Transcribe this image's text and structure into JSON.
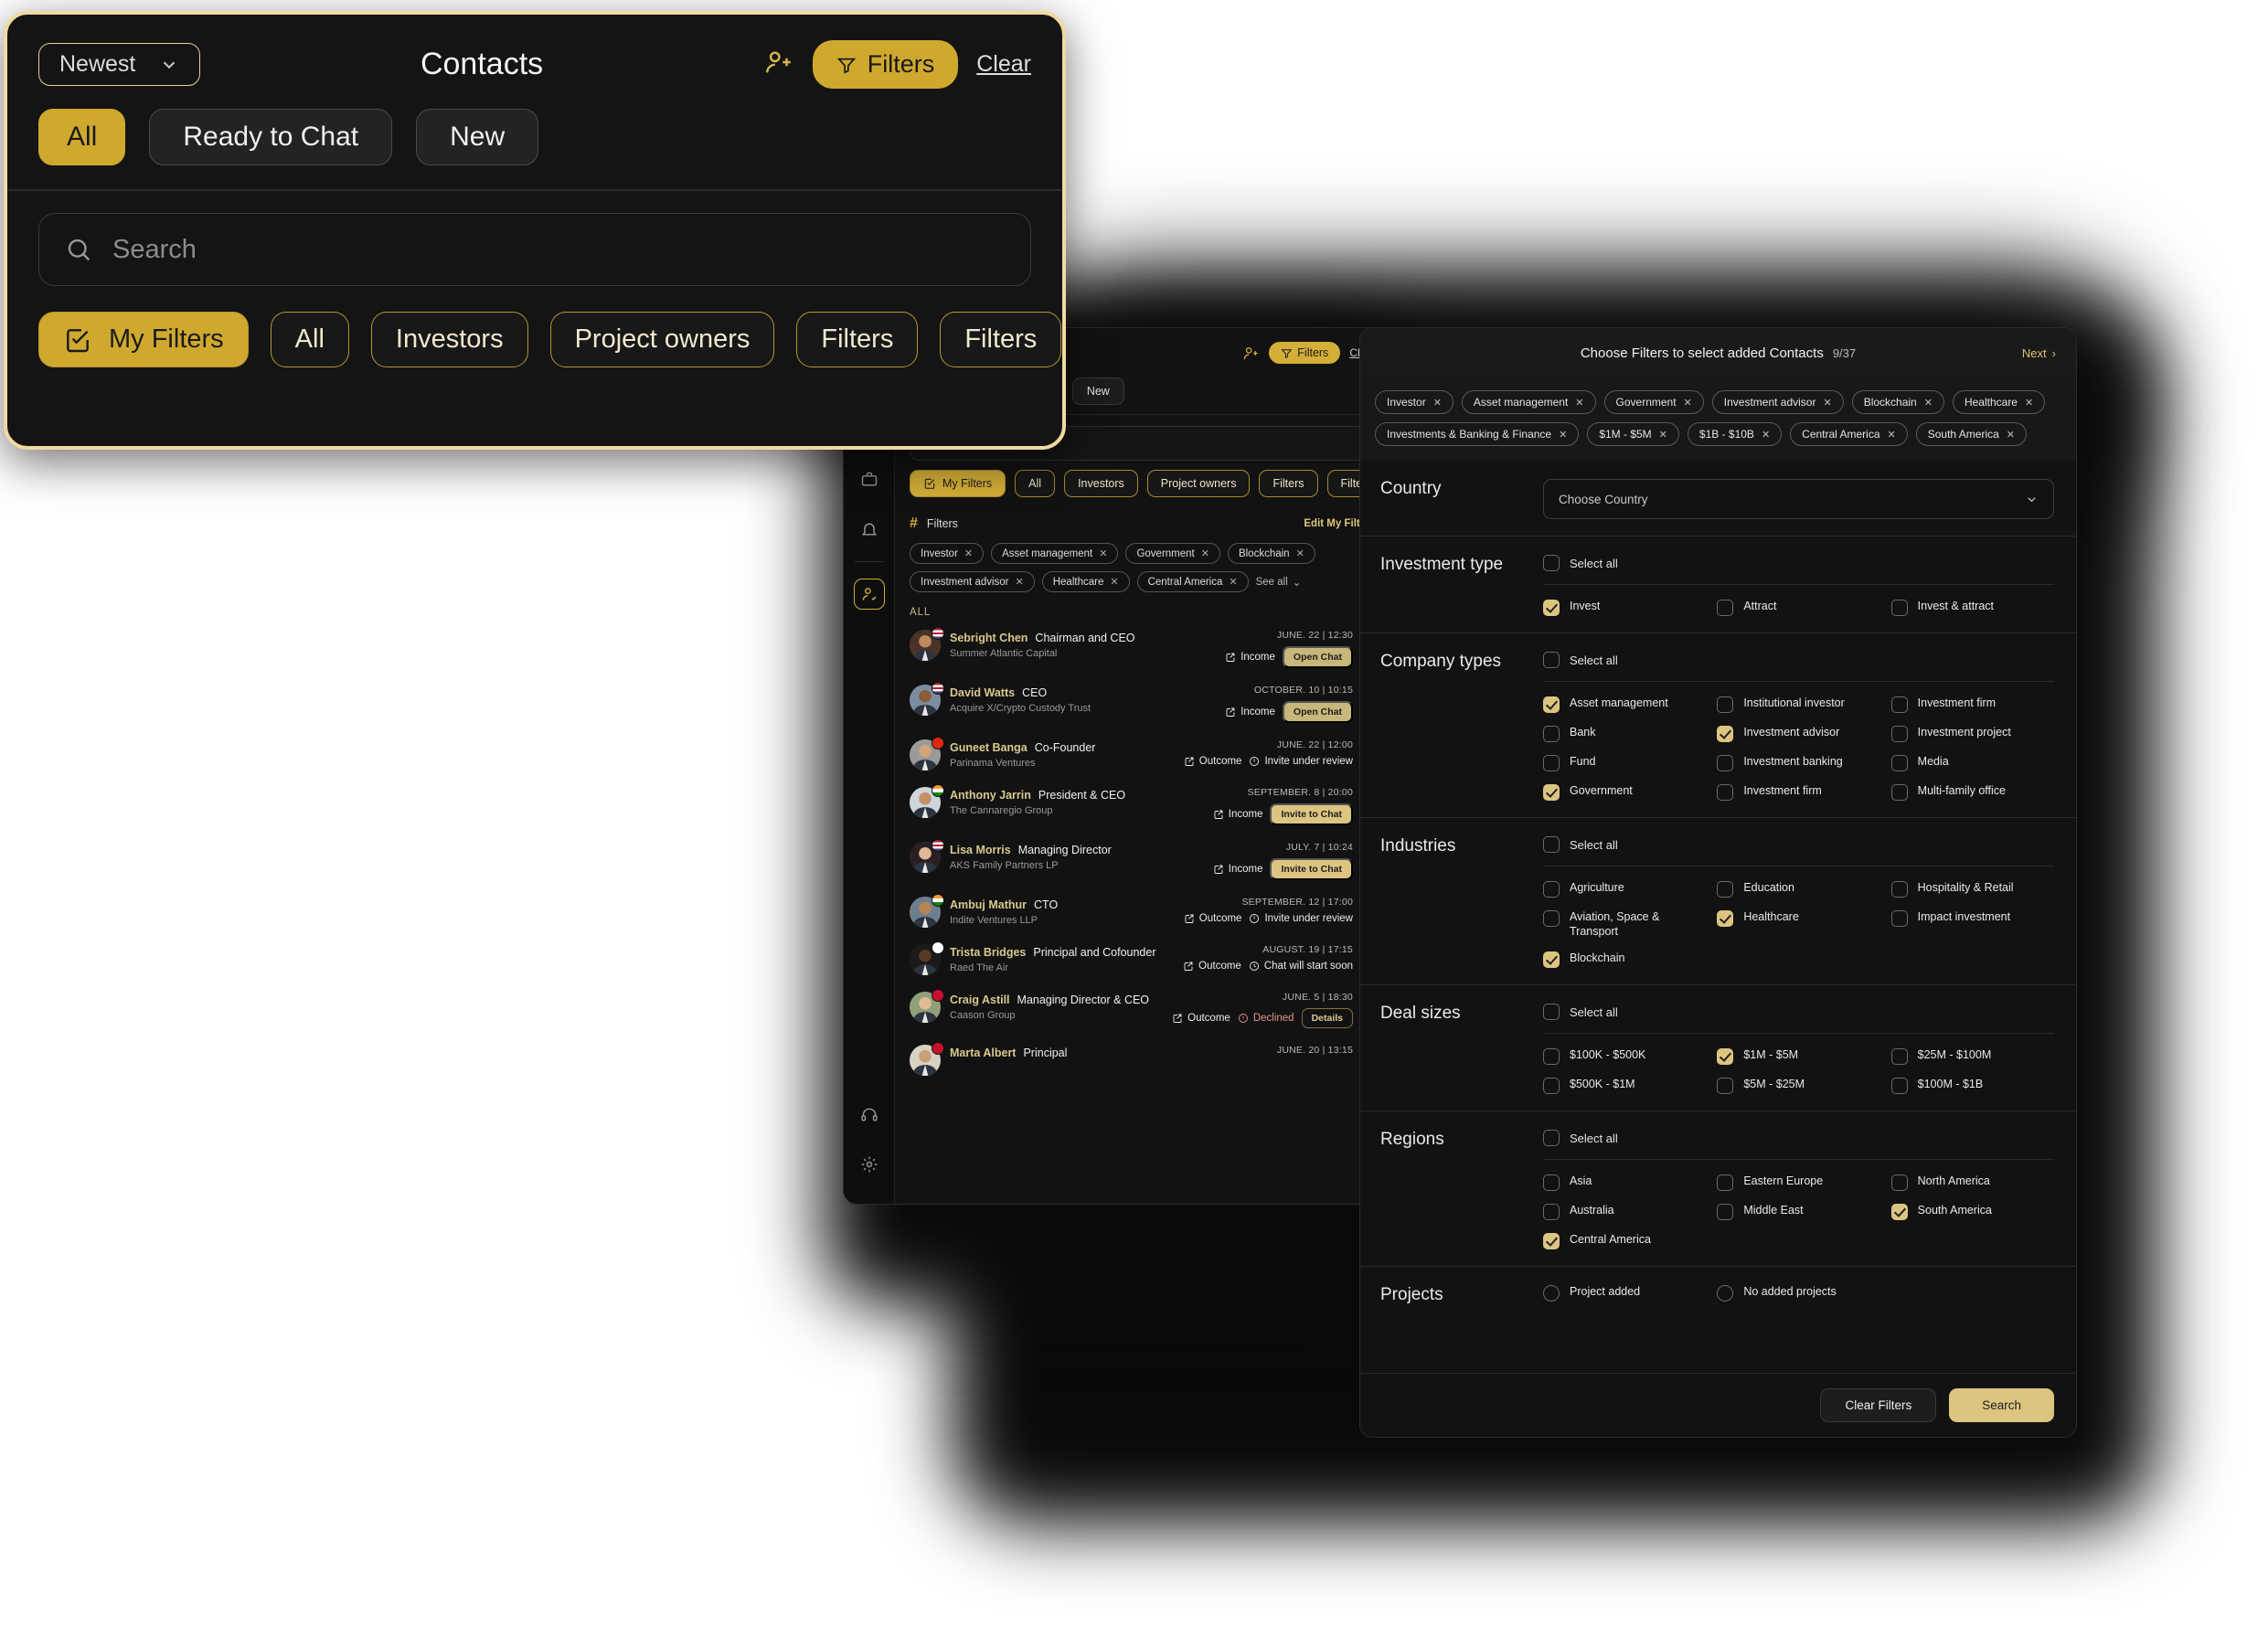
{
  "callout": {
    "sort_label": "Newest",
    "title": "Contacts",
    "filters_label": "Filters",
    "clear_label": "Clear",
    "segments": [
      {
        "label": "All",
        "active": true
      },
      {
        "label": "Ready to Chat",
        "active": false
      },
      {
        "label": "New",
        "active": false
      }
    ],
    "search_placeholder": "Search",
    "chips": [
      {
        "label": "My Filters",
        "active": true
      },
      {
        "label": "All",
        "active": false
      },
      {
        "label": "Investors",
        "active": false
      },
      {
        "label": "Project owners",
        "active": false
      },
      {
        "label": "Filters",
        "active": false
      },
      {
        "label": "Filters",
        "active": false
      }
    ]
  },
  "app": {
    "rail": [
      {
        "name": "stack-icon"
      },
      {
        "name": "document-add-icon"
      },
      {
        "name": "briefcase-icon"
      },
      {
        "name": "bell-icon"
      },
      {
        "name": "contacts-icon"
      },
      {
        "name": "support-headset-icon"
      },
      {
        "name": "gear-icon"
      }
    ],
    "title": "Contacts",
    "filters_label": "Filters",
    "clear_label": "Clear",
    "segments": [
      {
        "label": "All",
        "active": true
      },
      {
        "label": "Ready to Chat",
        "active": false
      },
      {
        "label": "New",
        "active": false
      }
    ],
    "search_placeholder": "Search",
    "chips": [
      {
        "label": "My Filters",
        "active": true
      },
      {
        "label": "All",
        "active": false
      },
      {
        "label": "Investors",
        "active": false
      },
      {
        "label": "Project owners",
        "active": false
      },
      {
        "label": "Filters",
        "active": false
      },
      {
        "label": "Filters",
        "active": false
      }
    ],
    "filters_bar": {
      "label": "Filters",
      "edit_label": "Edit My Filters"
    },
    "tags": [
      "Investor",
      "Asset management",
      "Government",
      "Blockchain",
      "Investment advisor",
      "Healthcare",
      "Central America"
    ],
    "see_all_label": "See all",
    "list_header": "ALL",
    "contacts": [
      {
        "name": "Sebright Chen",
        "role": "Chairman and CEO",
        "company": "Summer Atlantic Capital",
        "date": "JUNE. 22 | 12:30",
        "direction": "Income",
        "direction_icon": "income-icon",
        "action": "Open Chat",
        "action_style": "openchat",
        "status": "",
        "status_icon": "",
        "flag": "us"
      },
      {
        "name": "David Watts",
        "role": "CEO",
        "company": "Acquire X/Crypto Custody Trust",
        "date": "OCTOBER. 10 | 10:15",
        "direction": "Income",
        "direction_icon": "income-icon",
        "action": "Open Chat",
        "action_style": "openchat",
        "status": "",
        "status_icon": "",
        "flag": "us"
      },
      {
        "name": "Guneet Banga",
        "role": "Co-Founder",
        "company": "Parinama Ventures",
        "date": "JUNE. 22 | 12:00",
        "direction": "Outcome",
        "direction_icon": "outcome-icon",
        "action": "",
        "action_style": "",
        "status": "Invite under review",
        "status_icon": "exclamation-circle-icon",
        "flag": "hk"
      },
      {
        "name": "Anthony Jarrin",
        "role": "President & CEO",
        "company": "The Cannaregio Group",
        "date": "SEPTEMBER. 8 | 20:00",
        "direction": "Income",
        "direction_icon": "income-icon",
        "action": "Invite to Chat",
        "action_style": "invite",
        "status": "",
        "status_icon": "",
        "flag": "in"
      },
      {
        "name": "Lisa Morris",
        "role": "Managing Director",
        "company": "AKS Family Partners LP",
        "date": "JULY. 7 | 10:24",
        "direction": "Income",
        "direction_icon": "income-icon",
        "action": "Invite to Chat",
        "action_style": "invite",
        "status": "",
        "status_icon": "",
        "flag": "us"
      },
      {
        "name": "Ambuj Mathur",
        "role": "CTO",
        "company": "Indite Ventures LLP",
        "date": "SEPTEMBER. 12 | 17:00",
        "direction": "Outcome",
        "direction_icon": "outcome-icon",
        "action": "",
        "action_style": "",
        "status": "Invite under review",
        "status_icon": "exclamation-circle-icon",
        "flag": "in"
      },
      {
        "name": "Trista Bridges",
        "role": "Principal and Cofounder",
        "company": "Raed The Air",
        "date": "AUGUST. 19 | 17:15",
        "direction": "Outcome",
        "direction_icon": "outcome-icon",
        "action": "",
        "action_style": "",
        "status": "Chat will start soon",
        "status_icon": "clock-icon",
        "flag": "jp"
      },
      {
        "name": "Craig Astill",
        "role": "Managing Director & CEO",
        "company": "Caason Group",
        "date": "JUNE. 5 | 18:30",
        "direction": "Outcome",
        "direction_icon": "outcome-icon",
        "action": "Details",
        "action_style": "details",
        "status": "Declined",
        "status_icon": "exclamation-circle-icon",
        "flag": "uk"
      },
      {
        "name": "Marta Albert",
        "role": "Principal",
        "company": "",
        "date": "JUNE. 20 | 13:15",
        "direction": "",
        "direction_icon": "",
        "action": "",
        "action_style": "",
        "status": "",
        "status_icon": "",
        "flag": "uk"
      }
    ]
  },
  "modal": {
    "title": "Choose Filters to select added Contacts",
    "count": "9/37",
    "next_label": "Next",
    "tags": [
      "Investor",
      "Asset management",
      "Government",
      "Investment advisor",
      "Blockchain",
      "Healthcare",
      "Investments & Banking & Finance",
      "$1M - $5M",
      "$1B - $10B",
      "Central America",
      "South America"
    ],
    "country": {
      "label": "Country",
      "placeholder": "Choose Country"
    },
    "select_all_label": "Select all",
    "investment_type": {
      "label": "Investment type",
      "select_all": false,
      "options": [
        {
          "label": "Invest",
          "checked": true
        },
        {
          "label": "Attract",
          "checked": false
        },
        {
          "label": "Invest & attract",
          "checked": false
        }
      ]
    },
    "company_types": {
      "label": "Company types",
      "select_all": false,
      "options": [
        {
          "label": "Asset management",
          "checked": true
        },
        {
          "label": "Institutional investor",
          "checked": false
        },
        {
          "label": "Investment firm",
          "checked": false
        },
        {
          "label": "Bank",
          "checked": false
        },
        {
          "label": "Investment advisor",
          "checked": true
        },
        {
          "label": "Investment project",
          "checked": false
        },
        {
          "label": "Fund",
          "checked": false
        },
        {
          "label": "Investment banking",
          "checked": false
        },
        {
          "label": "Media",
          "checked": false
        },
        {
          "label": "Government",
          "checked": true
        },
        {
          "label": "Investment firm",
          "checked": false
        },
        {
          "label": "Multi-family office",
          "checked": false
        }
      ]
    },
    "industries": {
      "label": "Industries",
      "select_all": false,
      "options": [
        {
          "label": "Agriculture",
          "checked": false
        },
        {
          "label": "Education",
          "checked": false
        },
        {
          "label": "Hospitality & Retail",
          "checked": false
        },
        {
          "label": "Aviation, Space & Transport",
          "checked": false
        },
        {
          "label": "Healthcare",
          "checked": true
        },
        {
          "label": "Impact investment",
          "checked": false
        },
        {
          "label": "Blockchain",
          "checked": true
        }
      ]
    },
    "deal_sizes": {
      "label": "Deal sizes",
      "select_all": false,
      "options": [
        {
          "label": "$100K - $500K",
          "checked": false
        },
        {
          "label": "$1M - $5M",
          "checked": true
        },
        {
          "label": "$25M - $100M",
          "checked": false
        },
        {
          "label": "$500K - $1M",
          "checked": false
        },
        {
          "label": "$5M - $25M",
          "checked": false
        },
        {
          "label": "$100M - $1B",
          "checked": false
        }
      ]
    },
    "regions": {
      "label": "Regions",
      "select_all": false,
      "options": [
        {
          "label": "Asia",
          "checked": false
        },
        {
          "label": "Eastern Europe",
          "checked": false
        },
        {
          "label": "North America",
          "checked": false
        },
        {
          "label": "Australia",
          "checked": false
        },
        {
          "label": "Middle East",
          "checked": false
        },
        {
          "label": "South America",
          "checked": true
        },
        {
          "label": "Central America",
          "checked": true
        }
      ]
    },
    "projects": {
      "label": "Projects",
      "options": [
        {
          "label": "Project added",
          "checked": false
        },
        {
          "label": "No added projects",
          "checked": false
        }
      ]
    },
    "clear_filters_label": "Clear Filters",
    "search_label": "Search"
  },
  "colors": {
    "gold": "#d4af37",
    "gold_soft": "#ddc581",
    "panel": "#121212",
    "background": "#ffffff"
  }
}
